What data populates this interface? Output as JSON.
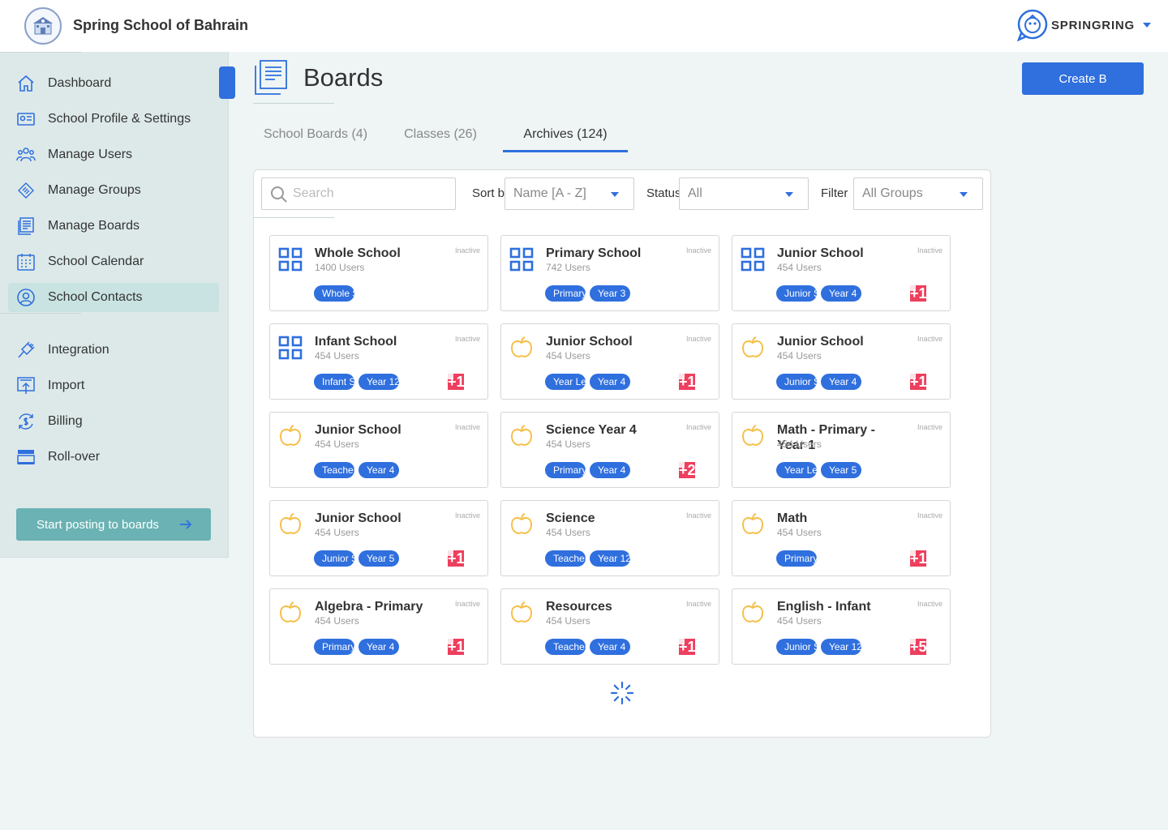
{
  "header": {
    "school_name": "Spring School of Bahrain",
    "brand_name": "SPRINGRING"
  },
  "sidebar": {
    "items": [
      {
        "label": "Dashboard",
        "icon": "home-icon"
      },
      {
        "label": "School Profile & Settings",
        "icon": "id-card-icon"
      },
      {
        "label": "Manage Users",
        "icon": "users-icon"
      },
      {
        "label": "Manage Groups",
        "icon": "groups-icon"
      },
      {
        "label": "Manage Boards",
        "icon": "boards-icon"
      },
      {
        "label": "School Calendar",
        "icon": "calendar-icon"
      },
      {
        "label": "School Contacts",
        "icon": "contacts-icon",
        "active": true
      },
      {
        "label": "Integration",
        "icon": "plug-icon"
      },
      {
        "label": "Import",
        "icon": "import-icon"
      },
      {
        "label": "Billing",
        "icon": "billing-icon"
      },
      {
        "label": "Roll-over",
        "icon": "rollover-icon"
      }
    ],
    "start_posting_label": "Start posting to boards"
  },
  "page": {
    "title": "Boards",
    "create_button_label": "Create B"
  },
  "tabs": [
    {
      "label": "School Boards (4)"
    },
    {
      "label": "Classes (26)"
    },
    {
      "label": "Archives (124)",
      "active": true
    }
  ],
  "controls": {
    "search_placeholder": "Search",
    "sort_label": "Sort by",
    "sort_value": "Name [A - Z]",
    "status_label": "Status",
    "status_value": "All",
    "filter_label": "Filter",
    "filter_value": "All Groups"
  },
  "colors": {
    "accent": "#2f6fde",
    "sidebar_bg": "#dde9e9",
    "active_item_bg": "#c9e3e2",
    "start_posting_bg": "#6ab2b3",
    "badge_red": "#ee3f5e",
    "apple_yellow": "#f5c04a"
  },
  "boards": [
    {
      "title": "Whole School",
      "users": "1400 Users",
      "status": "Inactive",
      "icon": "grid-icon",
      "tags": [
        "Whole S"
      ],
      "extra": ""
    },
    {
      "title": "Primary School",
      "users": "742 Users",
      "status": "Inactive",
      "icon": "grid-icon",
      "tags": [
        "Primary",
        "Year 3"
      ],
      "extra": ""
    },
    {
      "title": "Junior School",
      "users": "454 Users",
      "status": "Inactive",
      "icon": "grid-icon",
      "tags": [
        "Junior S",
        "Year 4"
      ],
      "extra": "+1"
    },
    {
      "title": "Infant School",
      "users": "454 Users",
      "status": "Inactive",
      "icon": "grid-icon",
      "tags": [
        "Infant S",
        "Year 12"
      ],
      "extra": "+1"
    },
    {
      "title": "Junior School",
      "users": "454 Users",
      "status": "Inactive",
      "icon": "apple-icon",
      "tags": [
        "Year Le",
        "Year 4"
      ],
      "extra": "+1"
    },
    {
      "title": "Junior School",
      "users": "454 Users",
      "status": "Inactive",
      "icon": "apple-icon",
      "tags": [
        "Junior S",
        "Year 4"
      ],
      "extra": "+1"
    },
    {
      "title": "Junior School",
      "users": "454 Users",
      "status": "Inactive",
      "icon": "apple-icon",
      "tags": [
        "Teacher",
        "Year 4"
      ],
      "extra": ""
    },
    {
      "title": "Science Year 4",
      "users": "454 Users",
      "status": "Inactive",
      "icon": "apple-icon",
      "tags": [
        "Primary",
        "Year 4"
      ],
      "extra": "+2"
    },
    {
      "title": "Math - Primary - Year 1",
      "users": "454 Users",
      "status": "Inactive",
      "icon": "apple-icon",
      "tags": [
        "Year Le",
        "Year 5"
      ],
      "extra": ""
    },
    {
      "title": "Junior School",
      "users": "454 Users",
      "status": "Inactive",
      "icon": "apple-icon",
      "tags": [
        "Junior S",
        "Year 5"
      ],
      "extra": "+1"
    },
    {
      "title": "Science",
      "users": "454 Users",
      "status": "Inactive",
      "icon": "apple-icon",
      "tags": [
        "Teacher",
        "Year 12"
      ],
      "extra": ""
    },
    {
      "title": "Math",
      "users": "454 Users",
      "status": "Inactive",
      "icon": "apple-icon",
      "tags": [
        "Primary"
      ],
      "extra": "+1"
    },
    {
      "title": "Algebra - Primary",
      "users": "454 Users",
      "status": "Inactive",
      "icon": "apple-icon",
      "tags": [
        "Primary",
        "Year 4"
      ],
      "extra": "+1"
    },
    {
      "title": "Resources",
      "users": "454 Users",
      "status": "Inactive",
      "icon": "apple-icon",
      "tags": [
        "Teacher",
        "Year 4"
      ],
      "extra": "+1"
    },
    {
      "title": "English - Infant",
      "users": "454 Users",
      "status": "Inactive",
      "icon": "apple-icon",
      "tags": [
        "Junior S",
        "Year 12"
      ],
      "extra": "+5"
    }
  ]
}
